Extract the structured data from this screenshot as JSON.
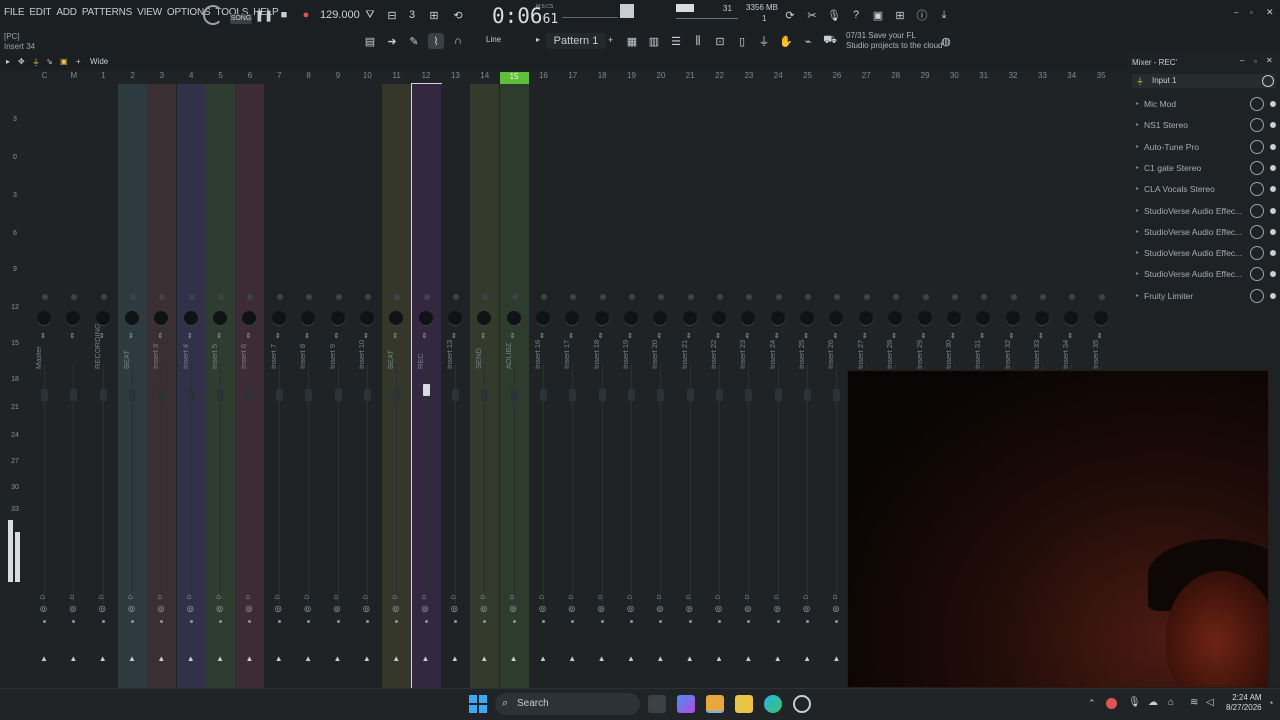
{
  "menu": [
    "FILE",
    "EDIT",
    "ADD",
    "PATTERNS",
    "VIEW",
    "OPTIONS",
    "TOOLS",
    "HELP"
  ],
  "transport": {
    "mode": "SONG",
    "tempo": "129.000",
    "time": "0:06",
    "time_sub": "61",
    "time_label": "M:S:CS",
    "cpu": "31",
    "mem": "3356 MB",
    "voices": "1"
  },
  "hint": {
    "line1": "[PC]",
    "line2": "Insert 34"
  },
  "toolbar": {
    "snap": "Line",
    "pattern": "Pattern 1",
    "view": "Wide"
  },
  "news": {
    "line1": "07/31  Save your FL",
    "line2": "Studio projects to the cloud"
  },
  "scale": [
    "3",
    "0",
    "3",
    "6",
    "9",
    "12",
    "15",
    "18",
    "21",
    "24",
    "27",
    "30",
    "33"
  ],
  "strips": [
    {
      "num": "C",
      "label": "Master",
      "color": "#1f2326"
    },
    {
      "num": "M",
      "label": "",
      "color": "#1f2326"
    },
    {
      "num": "1",
      "label": "RECORDING",
      "color": "#1f2326"
    },
    {
      "num": "2",
      "label": "BEAT",
      "color": "#2d3a40"
    },
    {
      "num": "3",
      "label": "Insert 3",
      "color": "#3a2f33"
    },
    {
      "num": "4",
      "label": "Insert 4",
      "color": "#33304a"
    },
    {
      "num": "5",
      "label": "Insert 5",
      "color": "#2f3d30"
    },
    {
      "num": "6",
      "label": "Insert 6",
      "color": "#3d2c35"
    },
    {
      "num": "7",
      "label": "Insert 7",
      "color": "#1f2326"
    },
    {
      "num": "8",
      "label": "Insert 8",
      "color": "#1f2326"
    },
    {
      "num": "9",
      "label": "Insert 9",
      "color": "#1f2326"
    },
    {
      "num": "10",
      "label": "Insert 10",
      "color": "#1f2326"
    },
    {
      "num": "11",
      "label": "BEAT",
      "color": "#343729"
    },
    {
      "num": "12",
      "label": "REC",
      "color": "#342840"
    },
    {
      "num": "13",
      "label": "Insert 13",
      "color": "#1f2326"
    },
    {
      "num": "14",
      "label": "SEND",
      "color": "#343a2c"
    },
    {
      "num": "15",
      "label": "ADLIBZ",
      "color": "#2e3c2d"
    },
    {
      "num": "16",
      "label": "Insert 16",
      "color": "#1f2326"
    },
    {
      "num": "17",
      "label": "Insert 17",
      "color": "#1f2326"
    },
    {
      "num": "18",
      "label": "Insert 18",
      "color": "#1f2326"
    },
    {
      "num": "19",
      "label": "Insert 19",
      "color": "#1f2326"
    },
    {
      "num": "20",
      "label": "Insert 20",
      "color": "#1f2326"
    },
    {
      "num": "21",
      "label": "Insert 21",
      "color": "#1f2326"
    },
    {
      "num": "22",
      "label": "Insert 22",
      "color": "#1f2326"
    },
    {
      "num": "23",
      "label": "Insert 23",
      "color": "#1f2326"
    },
    {
      "num": "24",
      "label": "Insert 24",
      "color": "#1f2326"
    },
    {
      "num": "25",
      "label": "Insert 25",
      "color": "#1f2326"
    },
    {
      "num": "26",
      "label": "Insert 26",
      "color": "#1f2326"
    },
    {
      "num": "27",
      "label": "Insert 27",
      "color": "#1f2326"
    },
    {
      "num": "28",
      "label": "Insert 28",
      "color": "#1f2326"
    },
    {
      "num": "29",
      "label": "Insert 29",
      "color": "#1f2326"
    },
    {
      "num": "30",
      "label": "Insert 30",
      "color": "#1f2326"
    },
    {
      "num": "31",
      "label": "Insert 31",
      "color": "#1f2326"
    },
    {
      "num": "32",
      "label": "Insert 32",
      "color": "#1f2326"
    },
    {
      "num": "33",
      "label": "Insert 33",
      "color": "#1f2326"
    },
    {
      "num": "34",
      "label": "Insert 34",
      "color": "#1f2326"
    },
    {
      "num": "35",
      "label": "Insert 35",
      "color": "#1f2326"
    }
  ],
  "mixer_panel": {
    "title": "Mixer - REC'",
    "input": "Input 1",
    "slots": [
      "Mic Mod",
      "NS1 Stereo",
      "Auto-Tune Pro",
      "C1 gate Stereo",
      "CLA Vocals Stereo",
      "StudioVerse Audio Effec...",
      "StudioVerse Audio Effec...",
      "StudioVerse Audio Effec...",
      "StudioVerse Audio Effec...",
      "Fruity Limiter"
    ]
  },
  "taskbar": {
    "search": "Search",
    "time": "2:24 AM",
    "date": "8/27/2026"
  },
  "colors": {
    "accent": "#5fbf3a",
    "rec": "#e0554f"
  }
}
